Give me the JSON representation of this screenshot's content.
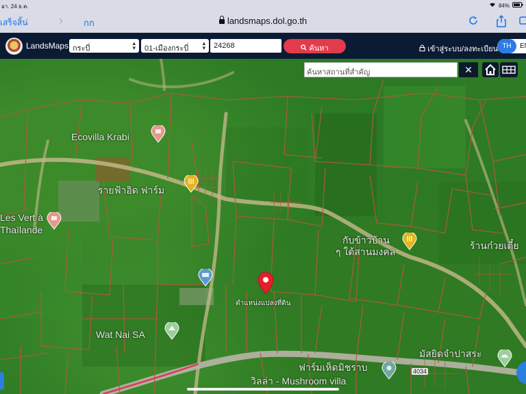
{
  "status_bar": {
    "time": "อา. 24 ธ.ค.",
    "battery": "84%"
  },
  "safari": {
    "done_label": "เสร็จสิ้น",
    "aa_label": "กก",
    "url": "landsmaps.dol.go.th"
  },
  "header": {
    "brand": "LandsMaps",
    "province": "กระบี่",
    "district": "01-เมืองกระบี่",
    "parcel_number": "24268",
    "search_button": "ค้นหา",
    "login": "เข้าสู่ระบบ/ลงทะเบียน",
    "lang_th": "TH",
    "lang_en": "EN"
  },
  "map": {
    "search_placeholder": "ค้นหาสถานที่สำคัญ",
    "clear_label": "✕",
    "labels": {
      "ecovilla": "Ecovilla Krabi",
      "restaurant": "รายฟ้าอิด ฟาร์ม",
      "les_vert": "Les Vert à",
      "thailande": "Thaïlande",
      "kub_kao": "กับข้าวบ้าน",
      "kub_kao2": "ๆ ใต้สานมงคล",
      "noodle": "ร้านก๋วยเตี๋ย",
      "pin_label": "ตำแหน่งแปลงที่ดิน",
      "wat": "Wat Nai SA",
      "mosque": "มัสยิดจำปาสระ",
      "farm1": "ฟาร์มเห็ดมิชราบ",
      "farm2": "วิลล่า - Mushroom villa",
      "road_no": "4034"
    },
    "colors": {
      "parcel_line": "#b05a3a",
      "road": "#c9b98d",
      "pin": "#e3202c"
    }
  }
}
